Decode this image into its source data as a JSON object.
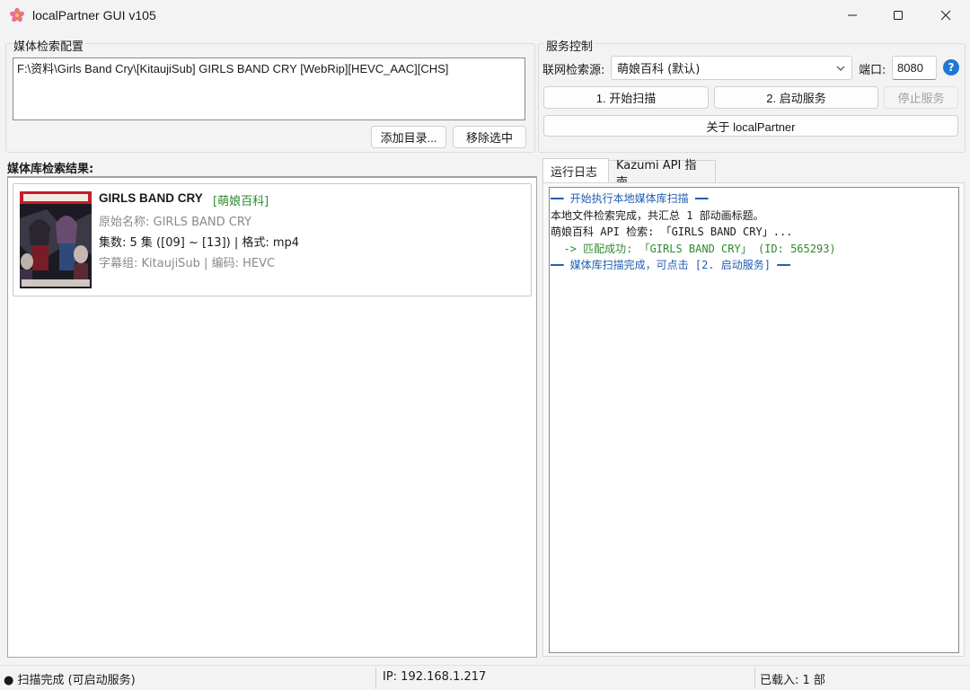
{
  "window": {
    "title": "localPartner GUI v105",
    "controls": {
      "minimize": "minimize",
      "maximize": "maximize",
      "close": "close"
    }
  },
  "media_config": {
    "group_label": "媒体检索配置",
    "paths": [
      "F:\\资料\\Girls Band Cry\\[KitaujiSub] GIRLS BAND CRY [WebRip][HEVC_AAC][CHS]"
    ],
    "add_dir_button": "添加目录...",
    "remove_selected_button": "移除选中"
  },
  "service_control": {
    "group_label": "服务控制",
    "source_label": "联网检索源:",
    "source_value": "萌娘百科 (默认)",
    "port_label": "端口:",
    "port_value": "8080",
    "help_icon": "?",
    "scan_button": "1. 开始扫描",
    "start_button": "2. 启动服务",
    "stop_button": "停止服务",
    "about_button": "关于 localPartner"
  },
  "results": {
    "title": "媒体库检索结果:",
    "items": [
      {
        "title": "GIRLS BAND CRY",
        "source": "[萌娘百科]",
        "original_name": "原始名称: GIRLS BAND CRY",
        "episodes": "集数: 5 集 ([09] ~ [13])  |  格式: mp4",
        "meta": "字幕组: KitaujiSub  |  编码: HEVC",
        "cover_icon": "anime-cover-image"
      }
    ]
  },
  "tabs": [
    {
      "label": "运行日志",
      "active": true
    },
    {
      "label": "Kazumi API 指南",
      "active": false
    }
  ],
  "log": {
    "lines": [
      {
        "text": "━━ 开始执行本地媒体库扫描 ━━",
        "color": "#1f5fb3"
      },
      {
        "text": "本地文件检索完成，共汇总 1 部动画标题。",
        "color": "#1a1a1a"
      },
      {
        "text": "萌娘百科 API 检索: 「GIRLS BAND CRY」...",
        "color": "#1a1a1a"
      },
      {
        "text": "  -> 匹配成功: 「GIRLS BAND CRY」 (ID: 565293)",
        "color": "#2e8b2e"
      },
      {
        "text": "━━ 媒体库扫描完成，可点击 [2. 启动服务] ━━",
        "color": "#1f5fb3"
      }
    ]
  },
  "status_bar": {
    "status": "● 扫描完成 (可启动服务)",
    "ip": "IP: 192.168.1.217",
    "loaded": "已载入: 1 部"
  }
}
